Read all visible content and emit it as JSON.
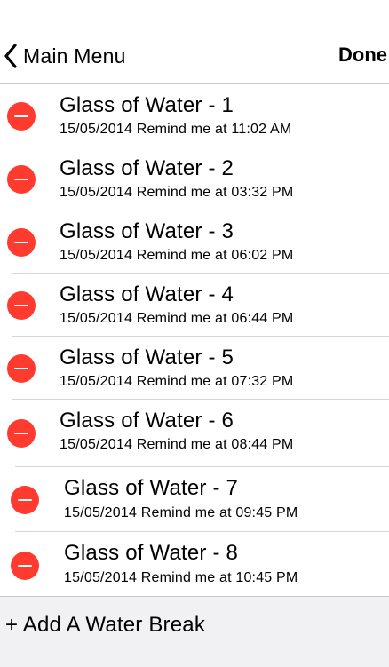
{
  "nav": {
    "back_label": "Main Menu",
    "done_label": "Done"
  },
  "items": [
    {
      "title": "Glass of Water - 1",
      "subtitle": "15/05/2014 Remind me at 11:02 AM"
    },
    {
      "title": "Glass of Water - 2",
      "subtitle": "15/05/2014 Remind me at 03:32 PM"
    },
    {
      "title": "Glass of Water - 3",
      "subtitle": "15/05/2014 Remind me at 06:02 PM"
    },
    {
      "title": "Glass of Water - 4",
      "subtitle": "15/05/2014 Remind me at 06:44 PM"
    },
    {
      "title": "Glass of Water - 5",
      "subtitle": "15/05/2014 Remind me at 07:32 PM"
    },
    {
      "title": "Glass of Water - 6",
      "subtitle": "15/05/2014 Remind me at 08:44 PM"
    },
    {
      "title": "Glass of Water - 7",
      "subtitle": "15/05/2014 Remind me at 09:45 PM"
    },
    {
      "title": "Glass of Water - 8",
      "subtitle": "15/05/2014 Remind me at 10:45 PM"
    }
  ],
  "footer": {
    "add_label": "+ Add A Water Break"
  },
  "colors": {
    "delete_red": "#ff3b30",
    "footer_bg": "#f1f1f3",
    "separator": "#d5d5d9"
  },
  "icons": {
    "back": "chevron-left-icon",
    "delete": "minus-circle-icon"
  }
}
